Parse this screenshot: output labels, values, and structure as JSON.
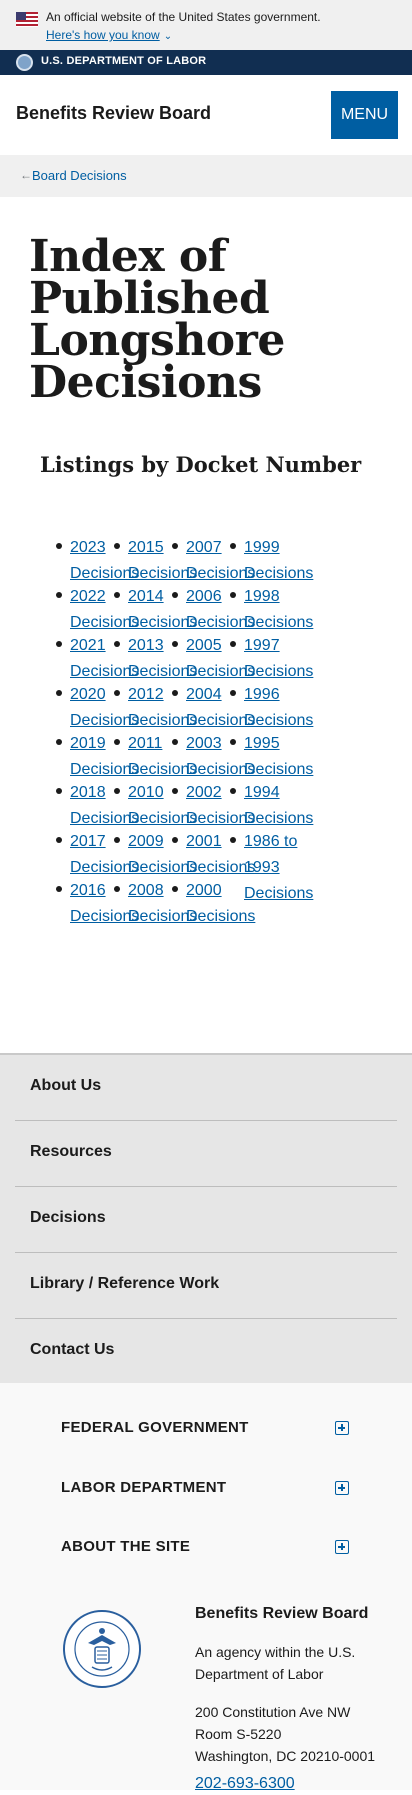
{
  "banner": {
    "official_text": "An official website of the United States government.",
    "how_you_know": "Here's how you know",
    "chevron_icon": "chevron-down-icon"
  },
  "agency_bar": {
    "label": "U.S. DEPARTMENT OF LABOR"
  },
  "header": {
    "site_title": "Benefits Review Board",
    "menu_label": "MENU"
  },
  "breadcrumb": {
    "back_icon": "arrow-left-icon",
    "link": "Board Decisions"
  },
  "main": {
    "title": "Index of Published Longshore Decisions",
    "section_title": "Listings by Docket Number",
    "columns": [
      [
        {
          "year": "2023",
          "suffix": "Decisions"
        },
        {
          "year": "2022",
          "suffix": "Decisions"
        },
        {
          "year": "2021",
          "suffix": "Decisions"
        },
        {
          "year": "2020",
          "suffix": "Decisions"
        },
        {
          "year": "2019",
          "suffix": "Decisions"
        },
        {
          "year": "2018",
          "suffix": "Decisions"
        },
        {
          "year": "2017",
          "suffix": "Decisions"
        },
        {
          "year": "2016",
          "suffix": "Decisions"
        }
      ],
      [
        {
          "year": "2015",
          "suffix": "Decisions"
        },
        {
          "year": "2014",
          "suffix": "Decisions"
        },
        {
          "year": "2013",
          "suffix": "Decisions"
        },
        {
          "year": "2012",
          "suffix": "Decisions"
        },
        {
          "year": "2011",
          "suffix": "Decisions"
        },
        {
          "year": "2010",
          "suffix": "Decisions"
        },
        {
          "year": "2009",
          "suffix": "Decisions"
        },
        {
          "year": "2008",
          "suffix": "Decisions"
        }
      ],
      [
        {
          "year": "2007",
          "suffix": "Decisions"
        },
        {
          "year": "2006",
          "suffix": "Decisions"
        },
        {
          "year": "2005",
          "suffix": "Decisions"
        },
        {
          "year": "2004",
          "suffix": "Decisions"
        },
        {
          "year": "2003",
          "suffix": "Decisions"
        },
        {
          "year": "2002",
          "suffix": "Decisions"
        },
        {
          "year": "2001",
          "suffix": "Decisions"
        },
        {
          "year": "2000",
          "suffix": "Decisions"
        }
      ],
      [
        {
          "year": "1999",
          "suffix": "Decisions"
        },
        {
          "year": "1998",
          "suffix": "Decisions"
        },
        {
          "year": "1997",
          "suffix": "Decisions"
        },
        {
          "year": "1996",
          "suffix": "Decisions"
        },
        {
          "year": "1995",
          "suffix": "Decisions"
        },
        {
          "year": "1994",
          "suffix": "Decisions"
        },
        {
          "year": "1986 to",
          "suffix": "1993 Decisions"
        }
      ]
    ]
  },
  "sidenav": {
    "items": [
      "About Us",
      "Resources",
      "Decisions",
      "Library / Reference Work",
      "Contact Us"
    ]
  },
  "footer": {
    "accordions": [
      "FEDERAL GOVERNMENT",
      "LABOR DEPARTMENT",
      "ABOUT THE SITE"
    ],
    "seal_text": "DEPARTMENT OF LABOR · UNITED STATES OF AMERICA",
    "org": "Benefits Review Board",
    "agency": "An agency within the U.S. Department of Labor",
    "address_line1": "200 Constitution Ave NW",
    "address_line2": "Room S-5220",
    "address_line3": "Washington, DC 20210-0001",
    "phone": "202-693-6300"
  },
  "colors": {
    "link": "#005ea2",
    "agency_bar": "#112e51",
    "banner_bg": "#f0f0f0",
    "nav_bg": "#e6e6e6"
  }
}
